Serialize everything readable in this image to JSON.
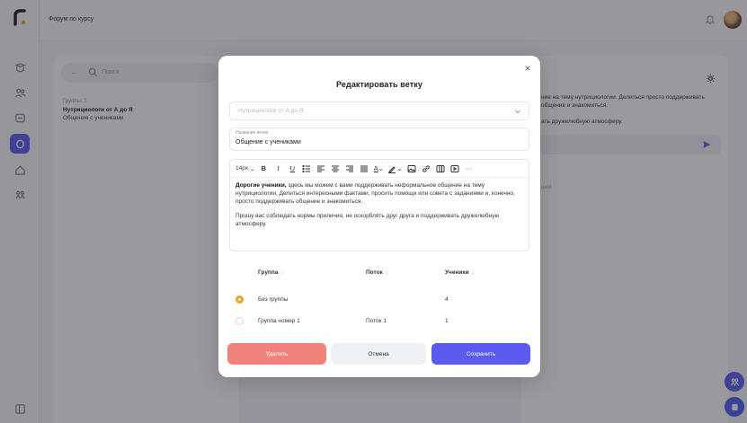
{
  "topbar": {
    "title": "Форум по курсу"
  },
  "leftpanel": {
    "search_placeholder": "Поиск",
    "meta": "Группы: 1",
    "thread_title": "Нутрициологи от А до Я",
    "thread_sub": "Общение с учениками"
  },
  "rightpanel": {
    "text1": "ние на тему нутрициологии. Делиться просто поддерживать общение и знакомиться.",
    "text2": "ать дружелюбную атмосферу.",
    "small": "шей"
  },
  "modal": {
    "title": "Редактировать ветку",
    "course_select": "Нутрициологи от А до Я",
    "name_label": "Название ветки",
    "name_value": "Общение с учениками",
    "font_size": "14px",
    "editor": {
      "para1_bold": "Дорогие ученики,",
      "para1_rest": " здесь мы можем с вами поддерживать неформальное общение на тему нутрициологии. Делиться интересными фактами, просить помощи или совета с заданиями и, конечно, просто поддерживать общение и знакомиться.",
      "para2": "Прошу вас соблюдать нормы приличия, не оскорблять друг друга и поддерживать дружелюбную атмосферу."
    },
    "table": {
      "headers": [
        "Группа",
        "Поток",
        "Ученики"
      ],
      "rows": [
        {
          "group": "Без группы",
          "stream": "",
          "students": "4",
          "selected": true
        },
        {
          "group": "Группа номер 1",
          "stream": "Поток 1",
          "students": "1",
          "selected": false
        }
      ]
    },
    "buttons": {
      "delete": "Удалить",
      "cancel": "Отмена",
      "save": "Сохранить"
    }
  },
  "colors": {
    "accent": "#5b5bf0",
    "danger": "#f0827a",
    "radio": "#f0a420"
  }
}
